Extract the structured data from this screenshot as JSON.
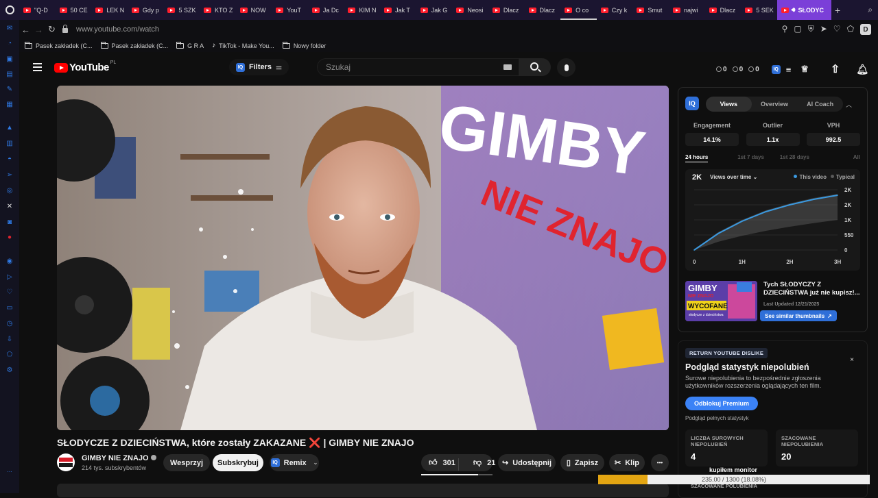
{
  "browser": {
    "tabs": [
      {
        "label": "\"Q-D"
      },
      {
        "label": "50 CE"
      },
      {
        "label": "LEK N"
      },
      {
        "label": "Gdy p"
      },
      {
        "label": "5 SZK"
      },
      {
        "label": "KTO Z"
      },
      {
        "label": "NOW"
      },
      {
        "label": "YouT"
      },
      {
        "label": "Ja Dc"
      },
      {
        "label": "KIM N"
      },
      {
        "label": "Jak T"
      },
      {
        "label": "Jak G"
      },
      {
        "label": "Neosi"
      },
      {
        "label": "Dlacz"
      },
      {
        "label": "Dlacz"
      },
      {
        "label": "O co"
      },
      {
        "label": "Czy k"
      },
      {
        "label": "Smut"
      },
      {
        "label": "najwi"
      },
      {
        "label": "Dlacz"
      },
      {
        "label": "5 SEK"
      }
    ],
    "active_tab": "SŁODYC",
    "new_tab": "+",
    "url": "www.youtube.com/watch",
    "profile_initial": "D",
    "bookmarks": [
      {
        "label": "Pasek zakładek (C..."
      },
      {
        "label": "Pasek zakładek (C..."
      },
      {
        "label": "G R A"
      },
      {
        "label": "TikTok - Make You..."
      },
      {
        "label": "Nowy folder"
      }
    ]
  },
  "youtube": {
    "logo_text": "YouTube",
    "country": "PL",
    "filters_label": "Filters",
    "search_placeholder": "Szukaj",
    "counters": [
      "0",
      "0",
      "0"
    ],
    "video_overlay_line1": "GIMBY",
    "video_overlay_line2": "NIE ZNAJO",
    "title_part1": "SŁODYCZE Z DZIECIŃSTWA, które zostały ZAKAZANE",
    "title_x": "❌",
    "title_part2": "| GIMBY NIE ZNAJO",
    "channel_name": "GIMBY NIE ZNAJO",
    "subscribers": "214 tys. subskrybentów",
    "support_label": "Wesprzyj",
    "subscribe_label": "Subskrybuj",
    "remix_label": "Remix",
    "likes": "301",
    "dislikes": "21",
    "share_label": "Udostępnij",
    "save_label": "Zapisz",
    "clip_label": "Klip",
    "more_label": "•••"
  },
  "vidiq": {
    "logo": "IQ",
    "tabs": [
      {
        "label": "Views"
      },
      {
        "label": "Overview"
      },
      {
        "label": "AI Coach"
      }
    ],
    "active_tab": "Views",
    "metrics": [
      {
        "label": "Engagement",
        "value": "14.1%"
      },
      {
        "label": "Outlier",
        "value": "1.1x"
      },
      {
        "label": "VPH",
        "value": "992.5"
      }
    ],
    "periods": [
      {
        "label": "24 hours"
      },
      {
        "label": "1st 7 days"
      },
      {
        "label": "1st 28 days"
      },
      {
        "label": "All"
      }
    ],
    "active_period": "24 hours",
    "graph_value": "2K",
    "graph_metric": "Views over time",
    "legend_this": "This video",
    "legend_typical": "Typical",
    "colors": {
      "this_video": "#3b9ae1",
      "typical": "#5a5a5a",
      "accent": "#2f6fd8"
    },
    "thumb_title": "Tych SŁODYCZY Z DZIECIŃSTWA już nie kupisz!...",
    "thumb_updated": "Last Updated 12/21/2025",
    "thumb_overlay_1": "GIMBY",
    "thumb_overlay_2": "NIE ZNAJO",
    "thumb_overlay_3": "WYCOFANE",
    "thumb_overlay_4": "słodycze z dzieciństwa",
    "similar_label": "See similar thumbnails"
  },
  "chart_data": {
    "type": "line",
    "title": "",
    "metric": "Views over time",
    "xlabel": "",
    "ylabel": "",
    "x_ticks": [
      "0",
      "1H",
      "2H",
      "3H"
    ],
    "y_ticks": [
      "0",
      "550",
      "1K",
      "2K",
      "2K"
    ],
    "x_range": [
      0,
      3
    ],
    "y_range": [
      0,
      2200
    ],
    "series": [
      {
        "name": "This video",
        "x": [
          0,
          0.5,
          1,
          1.5,
          2,
          2.5,
          3
        ],
        "y": [
          0,
          600,
          1050,
          1400,
          1650,
          1850,
          2000
        ]
      },
      {
        "name": "Typical",
        "band_low": [
          0,
          300,
          520,
          700,
          850,
          980,
          1100
        ],
        "band_high": [
          0,
          650,
          1100,
          1450,
          1700,
          1900,
          2050
        ]
      }
    ],
    "grid": true,
    "legend_position": "top-right"
  },
  "ryd": {
    "badge": "RETURN YOUTUBE DISLIKE",
    "close": "×",
    "title": "Podgląd statystyk niepolubień",
    "description": "Surowe niepolubienia to bezpośrednie zgłoszenia użytkowników rozszerzenia oglądających ten film.",
    "button": "Odblokuj Premium",
    "subtext": "Podgląd pełnych statystyk",
    "stat1_label": "LICZBA SUROWYCH NIEPOLUBIEŃ",
    "stat1_value": "4",
    "stat2_label": "SZACOWANE NIEPOLUBIENIA",
    "stat2_value": "20",
    "more_label": "SZACOWANE POLUBIENIA"
  },
  "toast": {
    "label": "kupiłem monitor",
    "text": "235.00 / 1300 (18.08%)",
    "progress_percent": 18.08,
    "color": "#e3a512"
  }
}
